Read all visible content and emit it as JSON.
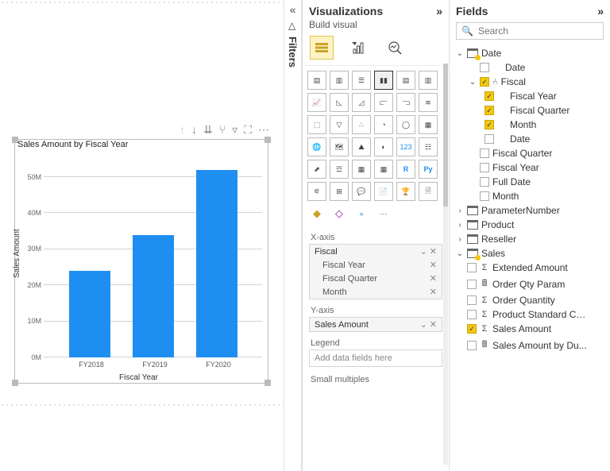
{
  "chart_data": {
    "type": "bar",
    "title": "Sales Amount by Fiscal Year",
    "categories": [
      "FY2018",
      "FY2019",
      "FY2020"
    ],
    "values": [
      24000000,
      34000000,
      52000000
    ],
    "xlabel": "Fiscal Year",
    "ylabel": "Sales Amount",
    "ylim": [
      0,
      55000000
    ],
    "yticks": [
      "0M",
      "10M",
      "20M",
      "30M",
      "40M",
      "50M"
    ]
  },
  "filters": {
    "label": "Filters"
  },
  "viz": {
    "title": "Visualizations",
    "sub": "Build visual",
    "xaxis_label": "X-axis",
    "yaxis_label": "Y-axis",
    "legend_label": "Legend",
    "smallmult_label": "Small multiples",
    "xaxis_group": "Fiscal",
    "xaxis_items": [
      "Fiscal Year",
      "Fiscal Quarter",
      "Month"
    ],
    "yaxis_items": [
      "Sales Amount"
    ],
    "legend_placeholder": "Add data fields here"
  },
  "fields": {
    "title": "Fields",
    "search_placeholder": "Search",
    "tree": {
      "date": {
        "label": "Date",
        "children": {
          "date_col": "Date",
          "fiscal": {
            "label": "Fiscal",
            "children": [
              "Fiscal Year",
              "Fiscal Quarter",
              "Month",
              "Date"
            ],
            "checked": [
              true,
              true,
              true,
              false
            ],
            "group_checked": true
          },
          "after": [
            "Fiscal Quarter",
            "Fiscal Year",
            "Full Date",
            "Month"
          ]
        }
      },
      "param": "ParameterNumber",
      "product": "Product",
      "reseller": "Reseller",
      "sales": {
        "label": "Sales",
        "children": [
          {
            "label": "Extended Amount",
            "sigma": true,
            "checked": false
          },
          {
            "label": "Order Qty Param",
            "calc": true,
            "checked": false
          },
          {
            "label": "Order Quantity",
            "sigma": true,
            "checked": false
          },
          {
            "label": "Product Standard Cost",
            "sigma": true,
            "checked": false
          },
          {
            "label": "Sales Amount",
            "sigma": true,
            "checked": true
          },
          {
            "label": "Sales Amount by Du...",
            "calc": true,
            "checked": false
          }
        ]
      }
    }
  }
}
